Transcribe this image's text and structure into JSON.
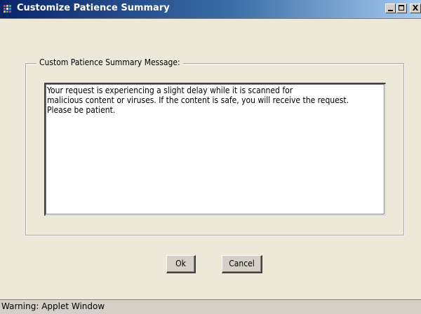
{
  "window": {
    "title": "Customize Patience Summary",
    "minimize_label": "_",
    "close_label": "X"
  },
  "groupbox": {
    "legend": "Custom Patience Summary Message:"
  },
  "message": {
    "text": "Your request is experiencing a slight delay while it is scanned for\nmalicious content or viruses. If the content is safe, you will receive the request.\nPlease be patient."
  },
  "buttons": {
    "ok_label": "Ok",
    "cancel_label": "Cancel"
  },
  "statusbar": {
    "text": "Warning: Applet Window"
  },
  "colors": {
    "titlebar_start": "#0a246a",
    "titlebar_end": "#a6caf0",
    "dialog_background": "#ece9d8"
  }
}
